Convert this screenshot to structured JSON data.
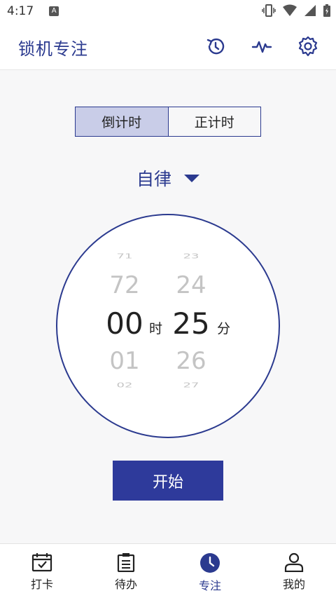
{
  "status_bar": {
    "time": "4:17",
    "notification_letter": "A"
  },
  "app_bar": {
    "title": "锁机专注",
    "actions": [
      "history-icon",
      "pulse-icon",
      "settings-icon"
    ]
  },
  "mode_toggle": {
    "options": [
      "倒计时",
      "正计时"
    ],
    "selected": "倒计时"
  },
  "focus_mode": {
    "label": "自律"
  },
  "timer_picker": {
    "hours": {
      "far_prev": "71",
      "prev": "72",
      "current": "00",
      "next": "01",
      "far_next": "02",
      "unit": "时"
    },
    "minutes": {
      "far_prev": "23",
      "prev": "24",
      "current": "25",
      "next": "26",
      "far_next": "27",
      "unit": "分"
    }
  },
  "start_button": {
    "label": "开始"
  },
  "bottom_nav": {
    "items": [
      {
        "label": "打卡",
        "icon": "calendar-check-icon"
      },
      {
        "label": "待办",
        "icon": "clipboard-icon"
      },
      {
        "label": "专注",
        "icon": "clock-icon"
      },
      {
        "label": "我的",
        "icon": "person-icon"
      }
    ],
    "active_index": 2
  },
  "colors": {
    "accent": "#2b3a8f",
    "button": "#2e3a9b",
    "segment_active": "#c9cde8",
    "faded_digit": "#c4c4c4"
  }
}
